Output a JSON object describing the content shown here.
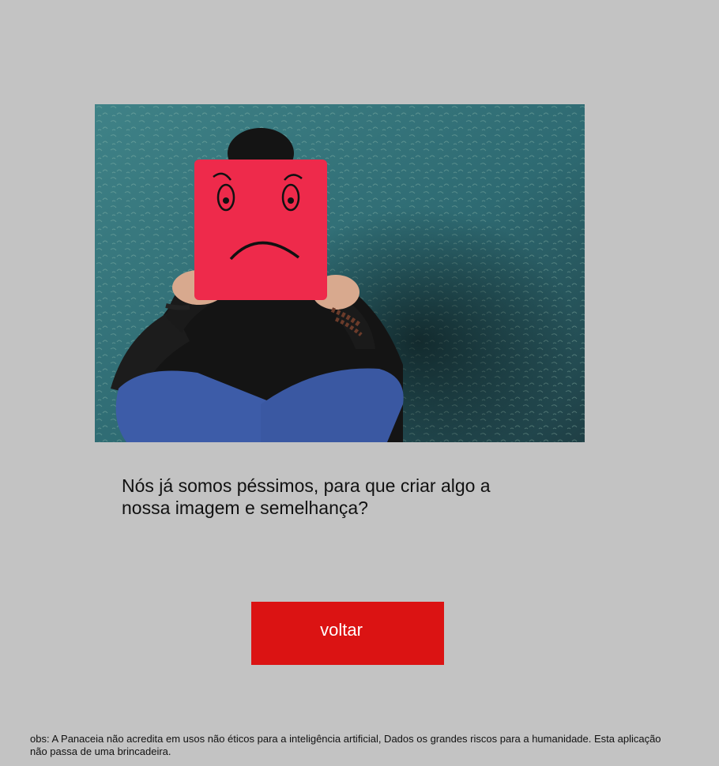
{
  "hero": {
    "image_icon": "sad-face-mask-photo",
    "palette": {
      "wall": "#2f6f77",
      "mask": "#ee2a4b",
      "jeans": "#3d5ca8",
      "clothing": "#141414"
    }
  },
  "message": {
    "text": "Nós já somos péssimos, para que criar algo a nossa imagem e semelhança?"
  },
  "back_button": {
    "label": "voltar",
    "color": "#db1313"
  },
  "footer": {
    "disclaimer": "obs: A Panaceia não acredita em usos não éticos para a inteligência artificial, Dados os grandes riscos para a humanidade. Esta aplicação não passa de uma brincadeira."
  },
  "colors": {
    "background": "#c3c3c3",
    "text": "#111111"
  }
}
